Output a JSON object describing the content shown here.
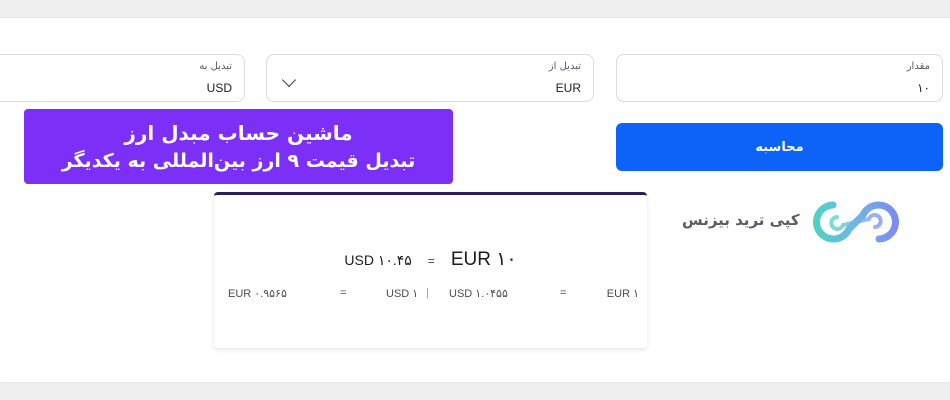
{
  "form": {
    "amount": {
      "label": "مقدار",
      "value": "۱۰"
    },
    "from": {
      "label": "تبدیل از",
      "value": "EUR"
    },
    "to": {
      "label": "تبدیل به",
      "value": "USD"
    },
    "calculate_label": "محاسبه"
  },
  "banner": {
    "line1": "ماشین حساب مبدل ارز",
    "line2": "تبدیل قیمت ۹ ارز بین‌المللی به یکدیگر",
    "color": "#7b2ff7"
  },
  "result": {
    "from_amount": "EUR ۱۰",
    "equals": "=",
    "to_amount": "USD ۱۰.۴۵",
    "rate_left": {
      "from": "EUR ۱",
      "equals": "=",
      "to": "USD ۱.۰۴۵۵"
    },
    "rate_right": {
      "from": "USD ۱",
      "equals": "=",
      "to": "EUR ۰.۹۵۶۵"
    },
    "separator": "|"
  },
  "brand": {
    "name": "کپی ترید بیزنس",
    "logo_icon": "infinity-logo-icon"
  },
  "colors": {
    "primary_button": "#0d63f8",
    "card_top_border": "#2a1f57"
  }
}
